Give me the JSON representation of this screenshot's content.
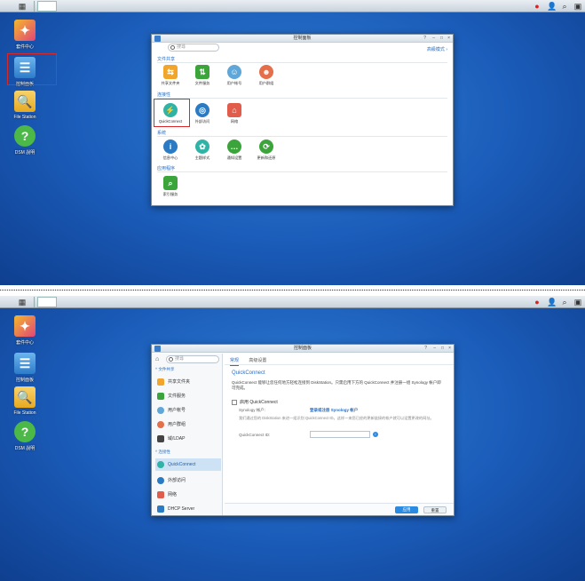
{
  "desktop_icons": [
    "套件中心",
    "控制面板",
    "File Station",
    "DSM 說明"
  ],
  "shot1": {
    "window": {
      "title": "控制面板",
      "search_placeholder": "搜尋",
      "advanced_mode": "高級模式",
      "sections": [
        {
          "title": "文件共享",
          "items": [
            "共享文件夹",
            "文件服务",
            "用户帐号",
            "用户群组"
          ]
        },
        {
          "title": "连接性",
          "items": [
            "QuickConnect",
            "外部访问",
            "网络"
          ]
        },
        {
          "title": "系统",
          "items": [
            "信息中心",
            "主题样式",
            "通知设置",
            "更新和还原"
          ]
        },
        {
          "title": "应用程序",
          "items": [
            "索引服务"
          ]
        }
      ]
    }
  },
  "shot2": {
    "window": {
      "title": "控制面板",
      "search_placeholder": "搜尋",
      "nav": {
        "group_file_sharing": "文件共享",
        "items_file": [
          "共享文件夹",
          "文件服务",
          "用户帐号",
          "用户群组",
          "域/LDAP"
        ],
        "group_connectivity": "连接性",
        "items_conn": [
          "QuickConnect",
          "外部访问",
          "网络",
          "DHCP Server"
        ]
      },
      "tabs": [
        "常规",
        "高级设置"
      ],
      "heading": "QuickConnect",
      "description": "QuickConnect 能够让您任何地方轻松连接到 DiskStation。只需启用下方的 QuickConnect 并注册一组 Synology 帐户即可完成。",
      "enable_label": "启用 QuickConnect",
      "account_label": "Synology 帐户:",
      "account_link": "登录或注册 Synology 帐户",
      "note": "我们通过您的 DiskStation 来进一组识别 QuickConnect ID。这样一来您已经的更新链接的帐户就可以设置更改的网址。",
      "id_label": "QuickConnect ID:",
      "apply": "应用",
      "reset": "重置"
    }
  }
}
